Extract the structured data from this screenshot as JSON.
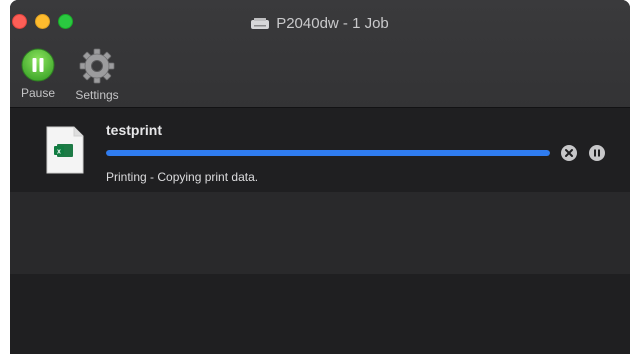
{
  "window": {
    "title": "P2040dw - 1 Job",
    "title_icon": "printer-icon"
  },
  "toolbar": {
    "pause_label": "Pause",
    "pause_icon": "pause-circle-icon",
    "settings_label": "Settings",
    "settings_icon": "gear-icon"
  },
  "job": {
    "name": "testprint",
    "status": "Printing - Copying print data.",
    "progress_fraction": 1.0,
    "doc_icon": "excel-document-icon",
    "cancel_icon": "cancel-circle-icon",
    "pause_icon": "pause-circle-icon"
  },
  "colors": {
    "accent": "#2f7cf0",
    "pause_green": "#5cc93c",
    "excel_green": "#1d7a45"
  }
}
